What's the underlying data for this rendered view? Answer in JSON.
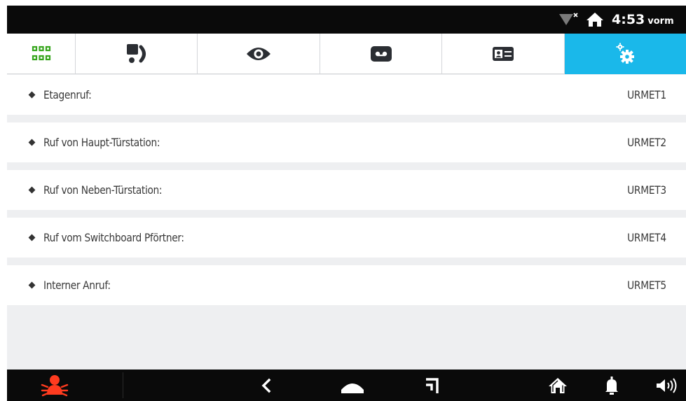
{
  "status_bar": {
    "time": "4:53",
    "time_suffix": "vorm",
    "icons": [
      "wifi-off-icon",
      "home-icon"
    ]
  },
  "tabs": [
    {
      "name": "apps",
      "icon": "apps-grid-icon",
      "color": "#36a51c",
      "active": false
    },
    {
      "name": "intercom",
      "icon": "intercom-call-icon",
      "color": "#2b2e33",
      "active": false
    },
    {
      "name": "monitor",
      "icon": "eye-icon",
      "color": "#2b2e33",
      "active": false
    },
    {
      "name": "voicemail",
      "icon": "voicemail-icon",
      "color": "#2b2e33",
      "active": false
    },
    {
      "name": "contacts",
      "icon": "contact-card-icon",
      "color": "#2b2e33",
      "active": false
    },
    {
      "name": "settings",
      "icon": "settings-gear-icon",
      "color": "#ffffff",
      "active": true
    }
  ],
  "settings_list": [
    {
      "label": "Etagenruf:",
      "value": "URMET1"
    },
    {
      "label": "Ruf von Haupt-Türstation:",
      "value": "URMET2"
    },
    {
      "label": "Ruf von Neben-Türstation:",
      "value": "URMET3"
    },
    {
      "label": "Ruf vom Switchboard Pförtner:",
      "value": "URMET4"
    },
    {
      "label": "Interner Anruf:",
      "value": "URMET5"
    }
  ],
  "nav_bar": {
    "alarm_icon": "alarm-beetle-icon",
    "alarm_color": "#ff3b1f",
    "buttons": [
      "back-icon",
      "home-dome-icon",
      "recent-apps-icon",
      "home-icon",
      "bell-icon",
      "volume-icon"
    ]
  },
  "colors": {
    "accent": "#1ab8ea",
    "apps_green": "#36a51c",
    "alarm_red": "#ff3b1f",
    "bar_black": "#0a0a0a",
    "background": "#eeeff1"
  }
}
